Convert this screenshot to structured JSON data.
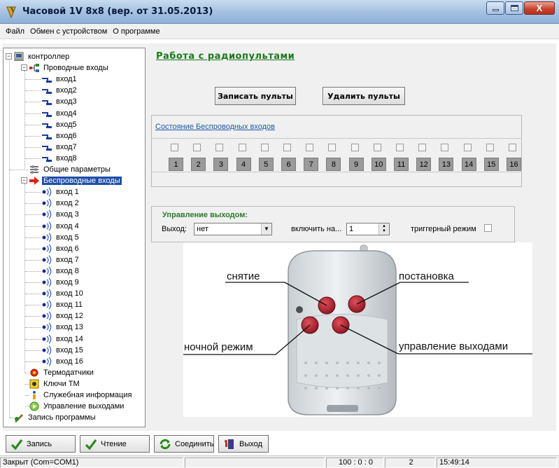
{
  "window": {
    "title": "Часовой 1V 8x8 (вер. от 31.05.2013)",
    "close_glyph": "X"
  },
  "menu": [
    "Файл",
    "Обмен с устройством",
    "О программе"
  ],
  "tree": {
    "root": "контроллер",
    "wired_group": "Проводные входы",
    "wired_items": [
      "вход1",
      "вход2",
      "вход3",
      "вход4",
      "вход5",
      "вход6",
      "вход7",
      "вход8"
    ],
    "general": "Общие параметры",
    "wireless_group": "Беспроводные входы",
    "wireless_items": [
      "вход 1",
      "вход 2",
      "вход 3",
      "вход 4",
      "вход 5",
      "вход 6",
      "вход 7",
      "вход 8",
      "вход 9",
      "вход 10",
      "вход 11",
      "вход 12",
      "вход 13",
      "вход 14",
      "вход 15",
      "вход 16"
    ],
    "thermo": "Термодатчики",
    "keys": "Ключи ТМ",
    "service": "Служебная информация",
    "outputs": "Управление выходами",
    "write": "Запись программы"
  },
  "content": {
    "title": "Работа с радиопультами",
    "write_remotes": "Записать пульты",
    "delete_remotes": "Удалить пульты",
    "wireless_state_title": "Состояние Беспроводных входов",
    "input_numbers": [
      "1",
      "2",
      "3",
      "4",
      "5",
      "6",
      "7",
      "8",
      "9",
      "10",
      "11",
      "12",
      "13",
      "14",
      "15",
      "16"
    ],
    "output_control": {
      "title": "Управление выходом:",
      "output_label": "Выход:",
      "output_value": "нет",
      "enable_label": "включить на...",
      "enable_value": "1",
      "trigger_label": "триггерный режим"
    },
    "photo_labels": {
      "disarm": "снятие",
      "arm": "постановка",
      "night": "ночной режим",
      "outputs": "управление выходами"
    }
  },
  "toolbar": {
    "write": "Запись",
    "read": "Чтение",
    "connect": "Соединить",
    "exit": "Выход"
  },
  "status": {
    "connection": "Закрыт (Com=COM1)",
    "counter": "100 : 0 : 0",
    "value": "2",
    "time": "15:49:14"
  }
}
